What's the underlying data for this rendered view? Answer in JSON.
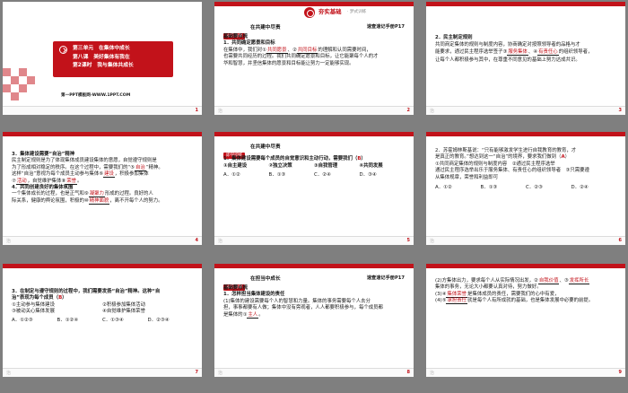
{
  "colors": {
    "accent": "#c2121a",
    "background": "#7f7f7f"
  },
  "slides": {
    "s1": {
      "lines": [
        "第三单元　在集体中成长",
        "第八课　美好集体有我在",
        "第2课时　我与集体共成长"
      ],
      "caption": "第一PPT模板网-WWW.1PPT.COM",
      "footer": "",
      "num": "1"
    },
    "s2": {
      "logo_title": "夯实基础",
      "logo_sub": "· 梦式训练",
      "tag": "知识清单",
      "section": "在共建中尽责",
      "ref": "速查速记手册P17",
      "heading": "基础要点梳",
      "point": "1．共同确定愿景和目标",
      "p1a": "在集体中，我们对①",
      "ans1": "共同愿景",
      "p1b": "、②",
      "ans2": "共同目标",
      "p1c": "的理解和认同需要时间，",
      "p2": "也需要共同经历的过程。我们共同确定愿景和目标，让它能聚每个人的才",
      "p3": "华和智慧，并坚信集体的愿景和目标能让努力一定能够实现。",
      "footer": "治",
      "num": "2"
    },
    "s3": {
      "heading": "2．民主制定规则",
      "p1": "共同商定集体的规则与制度内容，协商确定对按照领导者的品格与才",
      "p2a": "能要求，通过民主程序选举签子③",
      "ans3": "服务集体",
      "p2b": "、④",
      "ans4": "有责任心",
      "p2c": "的组织领导者，",
      "p3": "让每个人都积极参与其中，在尊重不同意见的基础上努力达成共识。",
      "footer": "治",
      "num": "3"
    },
    "s4": {
      "heading": "3．集体建设需要“自治”精神",
      "p1": "民主制定规则是为了体现集体成员建设集体的意愿，自觉遵守规则是",
      "p2": "为了形成相对稳定的秩序。在这个过程中，需要我们的“⑤",
      "ans5": "自治",
      "p2b": "”精神。",
      "p3a": "这样“自治”意视为每个成员主动参与集体⑥",
      "ans6": "建设",
      "p3b": "，积极参加集体",
      "p4a": "⑦",
      "ans7": "活动",
      "p4b": "，自觉维护集体⑧",
      "ans8": "荣誉",
      "p4c": "。",
      "heading2": "4．共同创建良好的集体氛围",
      "p5a": "一个集体成长的过程，也是正气和⑨",
      "ans9": "凝聚力",
      "p5b": "形成的过程。良好的人",
      "p6a": "际关系，健康的舆论氛围，积极的⑩",
      "ans10": "精神面貌",
      "p6b": "，离不开每个人的努力。",
      "footer": "治",
      "num": "4"
    },
    "s5": {
      "tag": "即学即练",
      "section": "在共建中尽责",
      "question": "1．集体建设需要每个成员的自觉意识和主动行动，需要我们（",
      "answer": "B",
      "question_end": "）",
      "items": [
        "①自主建设",
        "②独立决策",
        "③自我管理",
        "④共同发展"
      ],
      "options": [
        "A．①②",
        "B．①③",
        "C．②④",
        "D．③④"
      ],
      "footer": "治",
      "num": "5"
    },
    "s6": {
      "q1": "2．苏霍姆林斯基说：“只有能够激发学生进行自我教育的教育，才",
      "q2": "是真正的教育。”想达到这一“自治”的境界，要求我们做到（",
      "answer": "A",
      "q2e": "）",
      "i1": "①共同商定集体的规则与制度内容　②通过民主程序选举",
      "i2": "通过民主程序选举出乐于服务集体、有责任心的组织领导者　③只需要遵",
      "i3": "从集体规章，荣誉和利益即可",
      "options": [
        "A．①②",
        "B．①③",
        "C．②③",
        "D．②④"
      ],
      "footer": "治",
      "num": "6"
    },
    "s7": {
      "q1": "3．在制定与遵守规则的过程中，我们需要发扬“自治”精神。这种“自",
      "q2a": "治”表现为每个成员（",
      "answer": "B",
      "q2b": "）",
      "items": [
        "①主动参与集体建设",
        "②积极参加集体活动",
        "③被动关心集体发展",
        "④自觉维护集体荣誉"
      ],
      "options": [
        "A．①②③",
        "B．①②④",
        "C．①③④",
        "D．②③④"
      ],
      "footer": "治",
      "num": "7"
    },
    "s8": {
      "tag": "知识清单",
      "section": "在担当中成长",
      "ref": "速查速记手册P17",
      "heading": "基础要点梳",
      "point": "1．怎样担当集体建设的责任",
      "p1": "(1)集体的建设需要每个人的智慧和力量。集体的事务需要每个人去分",
      "p2": "担，事事都要有人做；集体中没有旁观者，人人都要积极参与，每个成员都",
      "p3a": "是集体的①",
      "ans1": "主人",
      "p3b": "。",
      "footer": "治",
      "num": "8"
    },
    "s9": {
      "p1a": "(2)方集体出力，要求每个人从实际情况出发，②",
      "ans2": "自我价值",
      "p1b": "、③",
      "ans3": "发挥所长",
      "p2": "集体的事务，无论大小都要认真对待，努力做好。",
      "p3a": "(3)④",
      "ans4": "集体荣誉",
      "p3b": "是集体成员的责任，需要我们的心中有爱，",
      "p4a": "(4)⑤",
      "ans5": "承担责任",
      "p4b": "就是每个人有所成就的基础，也是集体发展中必要的前提。",
      "footer": "治",
      "num": "9"
    }
  }
}
